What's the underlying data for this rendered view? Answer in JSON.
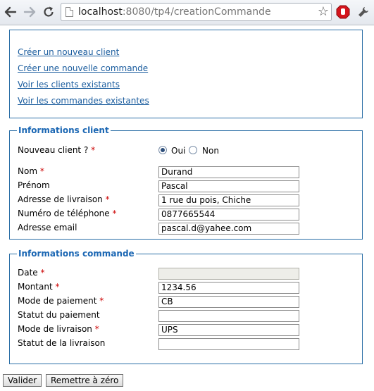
{
  "browser": {
    "url_host": "localhost",
    "url_rest": ":8080/tp4/creationCommande"
  },
  "menu": {
    "links": [
      "Créer un nouveau client",
      "Créer une nouvelle commande",
      "Voir les clients existants",
      "Voir les commandes existantes"
    ]
  },
  "client": {
    "legend": "Informations client",
    "nouveau_label": "Nouveau client ?",
    "oui": "Oui",
    "non": "Non",
    "fields": [
      {
        "label": "Nom",
        "required": "*",
        "value": "Durand"
      },
      {
        "label": "Prénom",
        "required": "",
        "value": "Pascal"
      },
      {
        "label": "Adresse de livraison",
        "required": "*",
        "value": "1 rue du pois, Chiche"
      },
      {
        "label": "Numéro de téléphone",
        "required": "*",
        "value": "0877665544"
      },
      {
        "label": "Adresse email",
        "required": "",
        "value": "pascal.d@yahee.com"
      }
    ]
  },
  "commande": {
    "legend": "Informations commande",
    "fields": [
      {
        "label": "Date",
        "required": "*",
        "value": ""
      },
      {
        "label": "Montant",
        "required": "*",
        "value": "1234.56"
      },
      {
        "label": "Mode de paiement",
        "required": "*",
        "value": "CB"
      },
      {
        "label": "Statut du paiement",
        "required": "",
        "value": ""
      },
      {
        "label": "Mode de livraison",
        "required": "*",
        "value": "UPS"
      },
      {
        "label": "Statut de la livraison",
        "required": "",
        "value": ""
      }
    ]
  },
  "buttons": {
    "valider": "Valider",
    "reset": "Remettre à zéro"
  },
  "icons": {
    "back": "back-arrow-icon",
    "forward": "forward-arrow-icon",
    "reload": "reload-icon",
    "bookmark": "star-icon",
    "adblock": "stop-icon",
    "menu": "wrench-icon"
  }
}
